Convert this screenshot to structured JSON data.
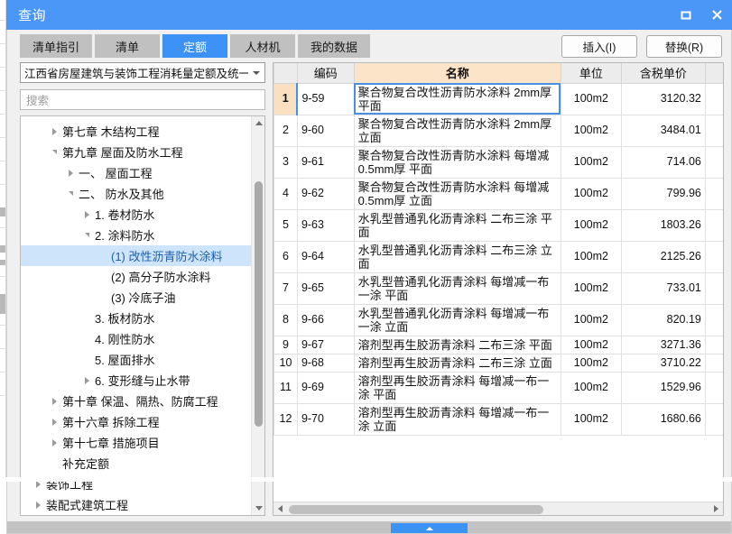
{
  "window": {
    "title": "查询",
    "maximize_label": "最大化",
    "close_label": "关闭"
  },
  "tabs": [
    {
      "label": "清单指引",
      "active": false
    },
    {
      "label": "清单",
      "active": false
    },
    {
      "label": "定额",
      "active": true
    },
    {
      "label": "人材机",
      "active": false
    },
    {
      "label": "我的数据",
      "active": false
    }
  ],
  "toolbar": {
    "insert_label": "插入(I)",
    "replace_label": "替换(R)"
  },
  "left_panel": {
    "combo_value": "江西省房屋建筑与装饰工程消耗量定额及统一基",
    "search_placeholder": "搜索",
    "tree": [
      {
        "label": "第七章  木结构工程",
        "indent": 1,
        "toggle": "collapsed",
        "selected": false
      },
      {
        "label": "第九章  屋面及防水工程",
        "indent": 1,
        "toggle": "expanded",
        "selected": false
      },
      {
        "label": "一、  屋面工程",
        "indent": 2,
        "toggle": "collapsed",
        "selected": false
      },
      {
        "label": "二、  防水及其他",
        "indent": 2,
        "toggle": "expanded",
        "selected": false
      },
      {
        "label": "1.  卷材防水",
        "indent": 3,
        "toggle": "collapsed",
        "selected": false
      },
      {
        "label": "2.  涂料防水",
        "indent": 3,
        "toggle": "expanded",
        "selected": false
      },
      {
        "label": "(1) 改性沥青防水涂料",
        "indent": 4,
        "toggle": "none",
        "selected": true
      },
      {
        "label": "(2) 高分子防水涂料",
        "indent": 4,
        "toggle": "none",
        "selected": false
      },
      {
        "label": "(3) 冷底子油",
        "indent": 4,
        "toggle": "none",
        "selected": false
      },
      {
        "label": "3.  板材防水",
        "indent": 3,
        "toggle": "none",
        "selected": false
      },
      {
        "label": "4.  刚性防水",
        "indent": 3,
        "toggle": "none",
        "selected": false
      },
      {
        "label": "5.  屋面排水",
        "indent": 3,
        "toggle": "none",
        "selected": false
      },
      {
        "label": "6.  变形缝与止水带",
        "indent": 3,
        "toggle": "collapsed",
        "selected": false
      },
      {
        "label": "第十章  保温、隔热、防腐工程",
        "indent": 1,
        "toggle": "collapsed",
        "selected": false
      },
      {
        "label": "第十六章  拆除工程",
        "indent": 1,
        "toggle": "collapsed",
        "selected": false
      },
      {
        "label": "第十七章  措施项目",
        "indent": 1,
        "toggle": "collapsed",
        "selected": false
      },
      {
        "label": "补充定额",
        "indent": 1,
        "toggle": "none",
        "selected": false
      },
      {
        "label": "装饰工程",
        "indent": 0,
        "toggle": "collapsed",
        "selected": false
      },
      {
        "label": "装配式建筑工程",
        "indent": 0,
        "toggle": "collapsed",
        "selected": false
      }
    ]
  },
  "grid": {
    "columns": [
      "",
      "编码",
      "名称",
      "单位",
      "含税单价",
      ""
    ],
    "rows": [
      {
        "n": "1",
        "code": "9-59",
        "name": "聚合物复合改性沥青防水涂料 2mm厚 平面",
        "unit": "100m2",
        "price": "3120.32",
        "selected": true
      },
      {
        "n": "2",
        "code": "9-60",
        "name": "聚合物复合改性沥青防水涂料 2mm厚 立面",
        "unit": "100m2",
        "price": "3484.01",
        "selected": false
      },
      {
        "n": "3",
        "code": "9-61",
        "name": "聚合物复合改性沥青防水涂料 每增减0.5mm厚 平面",
        "unit": "100m2",
        "price": "714.06",
        "selected": false
      },
      {
        "n": "4",
        "code": "9-62",
        "name": "聚合物复合改性沥青防水涂料 每增减0.5mm厚 立面",
        "unit": "100m2",
        "price": "799.96",
        "selected": false
      },
      {
        "n": "5",
        "code": "9-63",
        "name": "水乳型普通乳化沥青涂料 二布三涂 平面",
        "unit": "100m2",
        "price": "1803.26",
        "selected": false
      },
      {
        "n": "6",
        "code": "9-64",
        "name": "水乳型普通乳化沥青涂料 二布三涂 立面",
        "unit": "100m2",
        "price": "2125.26",
        "selected": false
      },
      {
        "n": "7",
        "code": "9-65",
        "name": "水乳型普通乳化沥青涂料 每增减一布一涂 平面",
        "unit": "100m2",
        "price": "733.01",
        "selected": false
      },
      {
        "n": "8",
        "code": "9-66",
        "name": "水乳型普通乳化沥青涂料 每增减一布一涂 立面",
        "unit": "100m2",
        "price": "820.19",
        "selected": false
      },
      {
        "n": "9",
        "code": "9-67",
        "name": "溶剂型再生胶沥青涂料 二布三涂 平面",
        "unit": "100m2",
        "price": "3271.36",
        "selected": false
      },
      {
        "n": "10",
        "code": "9-68",
        "name": "溶剂型再生胶沥青涂料 二布三涂 立面",
        "unit": "100m2",
        "price": "3710.22",
        "selected": false
      },
      {
        "n": "11",
        "code": "9-69",
        "name": "溶剂型再生胶沥青涂料 每增减一布一涂 平面",
        "unit": "100m2",
        "price": "1529.96",
        "selected": false
      },
      {
        "n": "12",
        "code": "9-70",
        "name": "溶剂型再生胶沥青涂料 每增减一布一涂 立面",
        "unit": "100m2",
        "price": "1680.66",
        "selected": false
      }
    ]
  },
  "colors": {
    "accent": "#3d93f5",
    "titlebar": "#4a97f7",
    "name_header": "#fbe4c8",
    "selected_row_num": "#fadfc0",
    "tree_selection": "#cde4fb"
  }
}
